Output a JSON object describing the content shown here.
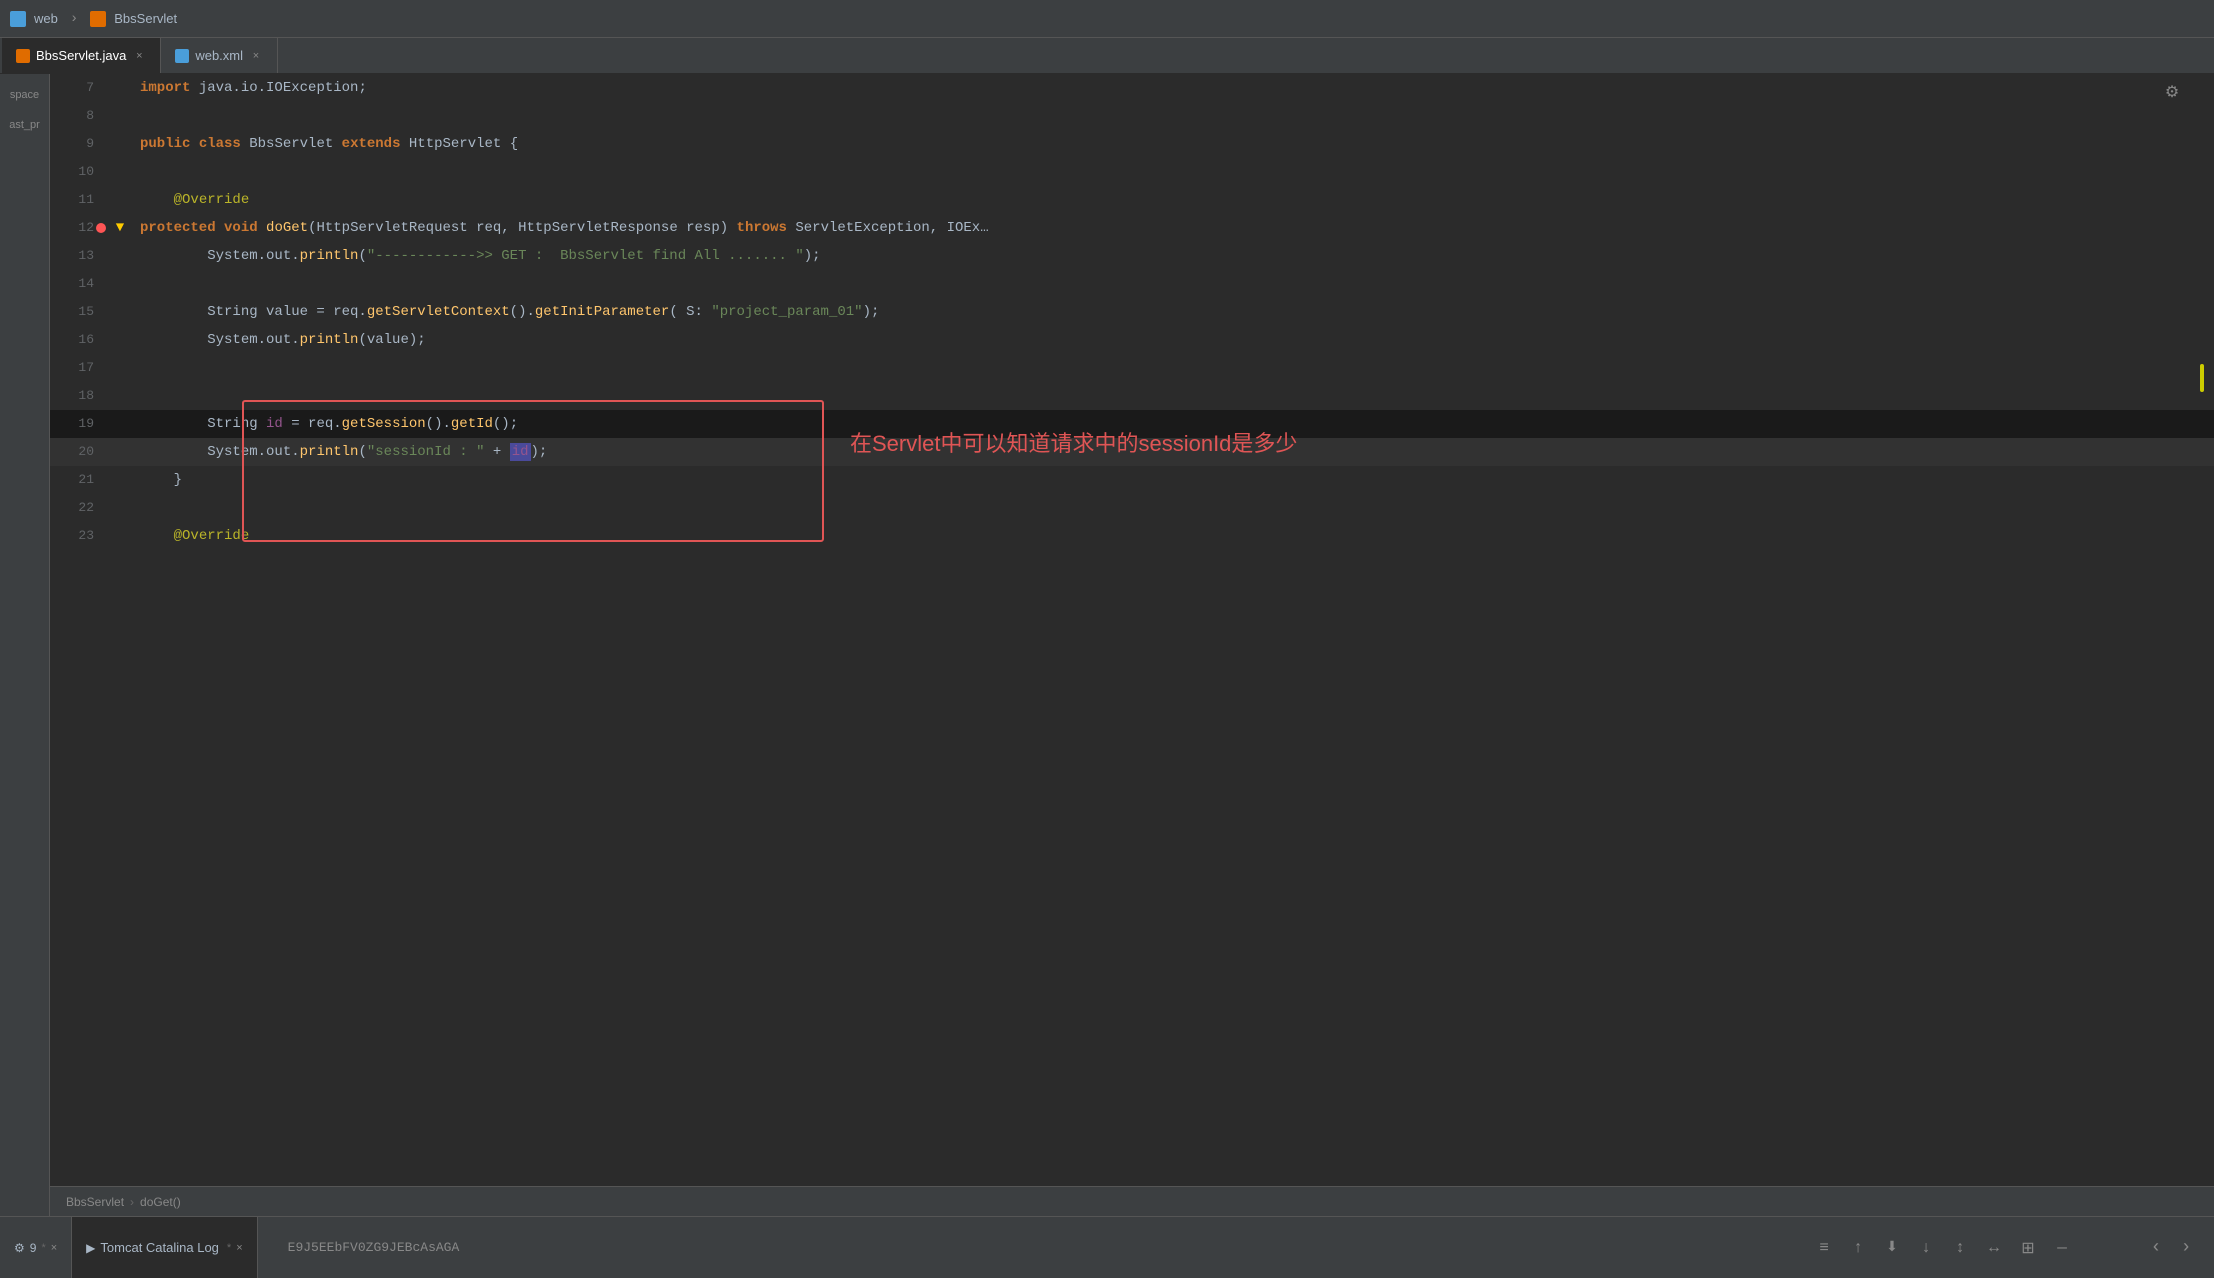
{
  "titleBar": {
    "breadcrumb": [
      "web",
      "BbsServlet"
    ]
  },
  "tabs": [
    {
      "label": "BbsServlet.java",
      "type": "java",
      "active": true
    },
    {
      "label": "web.xml",
      "type": "xml",
      "active": false
    }
  ],
  "sidebar": {
    "items": [
      "space",
      "ast_pr"
    ]
  },
  "codeLines": [
    {
      "num": 7,
      "indent": 0,
      "tokens": [
        {
          "t": "kw",
          "v": "import"
        },
        {
          "t": "plain",
          "v": " java.io.IOException;"
        }
      ]
    },
    {
      "num": 8,
      "indent": 0,
      "tokens": []
    },
    {
      "num": 9,
      "indent": 0,
      "tokens": [
        {
          "t": "kw",
          "v": "public"
        },
        {
          "t": "plain",
          "v": " "
        },
        {
          "t": "kw",
          "v": "class"
        },
        {
          "t": "plain",
          "v": " BbsServlet "
        },
        {
          "t": "kw",
          "v": "extends"
        },
        {
          "t": "plain",
          "v": " HttpServlet {"
        }
      ]
    },
    {
      "num": 10,
      "indent": 0,
      "tokens": []
    },
    {
      "num": 11,
      "indent": 1,
      "tokens": [
        {
          "t": "annot",
          "v": "@Override"
        }
      ]
    },
    {
      "num": 12,
      "indent": 1,
      "tokens": [
        {
          "t": "kw",
          "v": "protected"
        },
        {
          "t": "plain",
          "v": " "
        },
        {
          "t": "kw",
          "v": "void"
        },
        {
          "t": "plain",
          "v": " "
        },
        {
          "t": "method",
          "v": "doGet"
        },
        {
          "t": "plain",
          "v": "(HttpServletRequest req, HttpServletResponse resp) "
        },
        {
          "t": "kw",
          "v": "throws"
        },
        {
          "t": "plain",
          "v": " ServletException, IOEx…"
        }
      ],
      "breakpoint": true,
      "hasArrow": true
    },
    {
      "num": 13,
      "indent": 2,
      "tokens": [
        {
          "t": "plain",
          "v": "System.out."
        },
        {
          "t": "method",
          "v": "println"
        },
        {
          "t": "plain",
          "v": "("
        },
        {
          "t": "str",
          "v": "\"------------>> GET :  BbsServlet find All ....... \""
        },
        {
          "t": "plain",
          "v": ");"
        }
      ]
    },
    {
      "num": 14,
      "indent": 0,
      "tokens": []
    },
    {
      "num": 15,
      "indent": 2,
      "tokens": [
        {
          "t": "plain",
          "v": "String value = req."
        },
        {
          "t": "method",
          "v": "getServletContext"
        },
        {
          "t": "plain",
          "v": "()."
        },
        {
          "t": "method",
          "v": "getInitParameter"
        },
        {
          "t": "plain",
          "v": "( S: "
        },
        {
          "t": "str",
          "v": "\"project_param_01\""
        },
        {
          "t": "plain",
          "v": ");"
        }
      ]
    },
    {
      "num": 16,
      "indent": 2,
      "tokens": [
        {
          "t": "plain",
          "v": "System.out."
        },
        {
          "t": "method",
          "v": "println"
        },
        {
          "t": "plain",
          "v": "(value);"
        }
      ]
    },
    {
      "num": 17,
      "indent": 0,
      "tokens": []
    },
    {
      "num": 18,
      "indent": 0,
      "tokens": []
    },
    {
      "num": 19,
      "indent": 2,
      "tokens": [
        {
          "t": "plain",
          "v": "String "
        },
        {
          "t": "param",
          "v": "id"
        },
        {
          "t": "plain",
          "v": " = req."
        },
        {
          "t": "method",
          "v": "getSession"
        },
        {
          "t": "plain",
          "v": "()."
        },
        {
          "t": "method",
          "v": "getId"
        },
        {
          "t": "plain",
          "v": "();"
        }
      ],
      "highlighted": true
    },
    {
      "num": 20,
      "indent": 2,
      "tokens": [
        {
          "t": "plain",
          "v": "System.out."
        },
        {
          "t": "method",
          "v": "println"
        },
        {
          "t": "plain",
          "v": "("
        },
        {
          "t": "str",
          "v": "\"sessionId : \""
        },
        {
          "t": "plain",
          "v": " + "
        },
        {
          "t": "param",
          "v": "id"
        },
        {
          "t": "plain",
          "v": ");"
        }
      ],
      "highlighted": true,
      "activeHighlight": true
    },
    {
      "num": 21,
      "indent": 1,
      "tokens": [
        {
          "t": "plain",
          "v": "}"
        }
      ]
    },
    {
      "num": 22,
      "indent": 0,
      "tokens": []
    },
    {
      "num": 23,
      "indent": 1,
      "tokens": [
        {
          "t": "annot",
          "v": "@Override"
        }
      ]
    }
  ],
  "highlightBox": {
    "label": "在Servlet中可以知道请求中的sessionId是多少"
  },
  "breadcrumbFooter": {
    "class": "BbsServlet",
    "method": "doGet()"
  },
  "bottomPanel": {
    "tabs": [
      {
        "label": "9",
        "icon": "⚙",
        "active": false
      },
      {
        "label": "Tomcat Catalina Log",
        "active": true,
        "hasPin": true
      }
    ],
    "logText": "E9J5EEbFV0ZG9JEBcAsAGA",
    "toolbarButtons": [
      "≡",
      "↑",
      "↓",
      "⬇",
      "↕",
      "↔",
      "☰",
      "⊞",
      "—"
    ]
  }
}
